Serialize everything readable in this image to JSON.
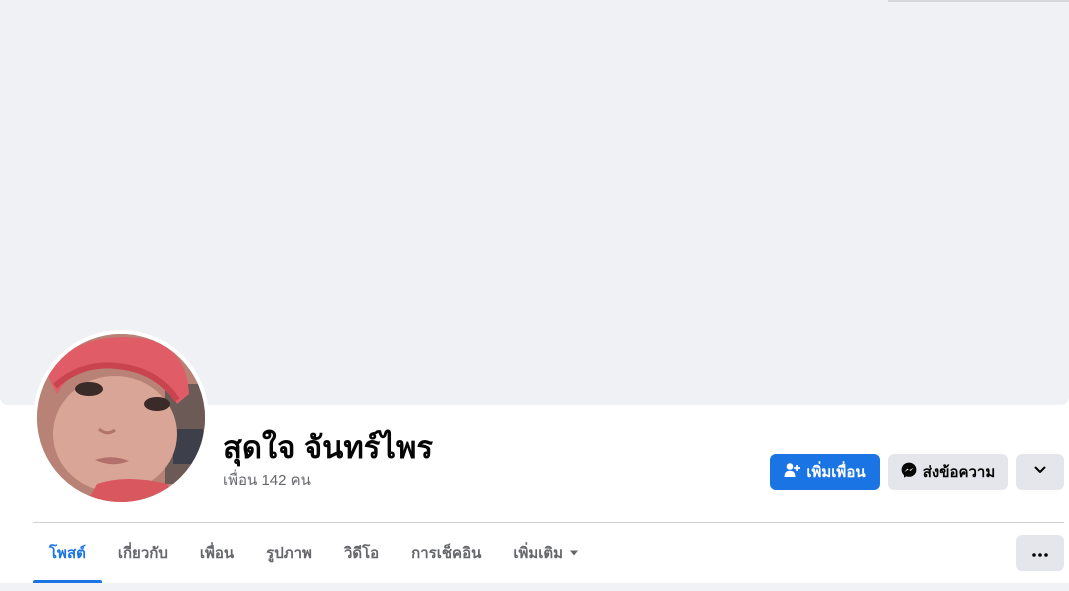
{
  "profile": {
    "name": "สุดใจ จันทร์ไพร",
    "friend_count": "เพื่อน 142 คน"
  },
  "actions": {
    "add_friend_label": "เพิ่มเพื่อน",
    "add_friend_icon": "person-add-icon",
    "message_label": "ส่งข้อความ",
    "message_icon": "messenger-icon",
    "more_icon": "chevron-down-icon"
  },
  "tabs": [
    {
      "label": "โพสต์",
      "active": true
    },
    {
      "label": "เกี่ยวกับ",
      "active": false
    },
    {
      "label": "เพื่อน",
      "active": false
    },
    {
      "label": "รูปภาพ",
      "active": false
    },
    {
      "label": "วิดีโอ",
      "active": false
    },
    {
      "label": "การเช็คอิน",
      "active": false
    },
    {
      "label": "เพิ่มเติม",
      "active": false,
      "icon": "caret-down-icon"
    }
  ],
  "tabs_more_icon": "ellipsis-icon",
  "colors": {
    "accent": "#1b74e4",
    "cover": "#f0f1f4",
    "secondary_button": "#e4e6eb",
    "secondary_text": "#65676b"
  }
}
